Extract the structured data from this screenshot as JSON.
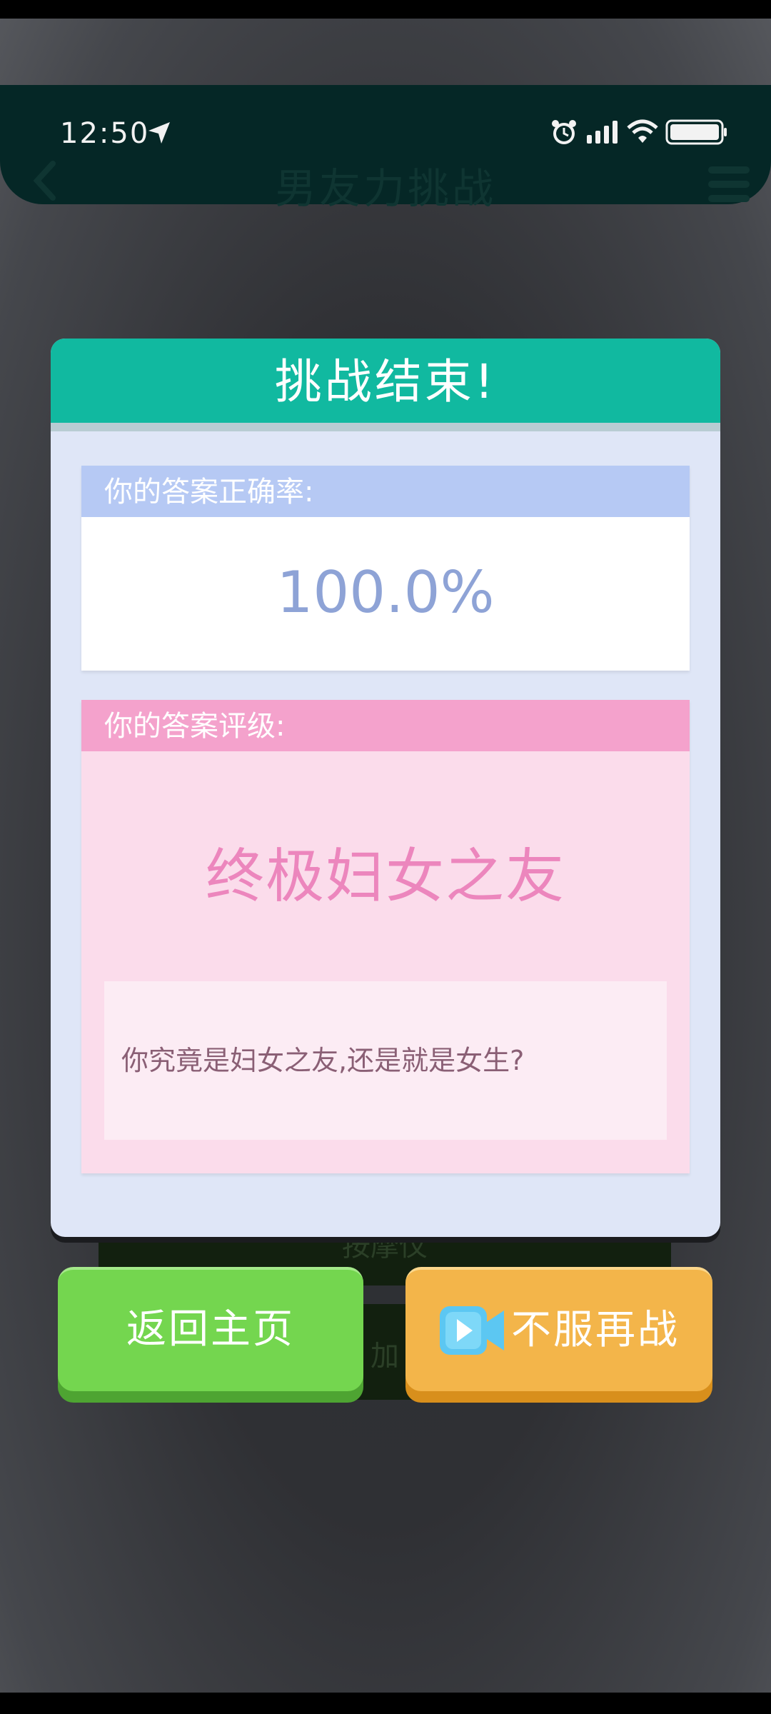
{
  "status_bar": {
    "time": "12:50",
    "location_icon": "location-arrow-icon",
    "right_icons": [
      "alarm-icon",
      "signal-icon",
      "wifi-icon",
      "battery-icon"
    ]
  },
  "header": {
    "title": "男友力挑战",
    "back_icon": "chevron-left-icon",
    "menu_icon": "menu-icon"
  },
  "background_panels": {
    "panel1_label": "按摩仪",
    "panel2_label": "加"
  },
  "dialog": {
    "title": "挑战结束!",
    "accuracy": {
      "label": "你的答案正确率:",
      "value": "100.0%"
    },
    "rating": {
      "label": "你的答案评级:",
      "title": "终极妇女之友",
      "description": "你究竟是妇女之友,还是就是女生?"
    }
  },
  "buttons": {
    "home": "返回主页",
    "retry": "不服再战",
    "retry_icon": "video-camera-icon"
  },
  "colors": {
    "header_bg": "#052726",
    "dialog_head": "#11b9a0",
    "accuracy_label": "#b6c9f4",
    "rating_label": "#f4a2cc",
    "home_button": "#74d64f",
    "retry_button": "#f3b54a"
  }
}
